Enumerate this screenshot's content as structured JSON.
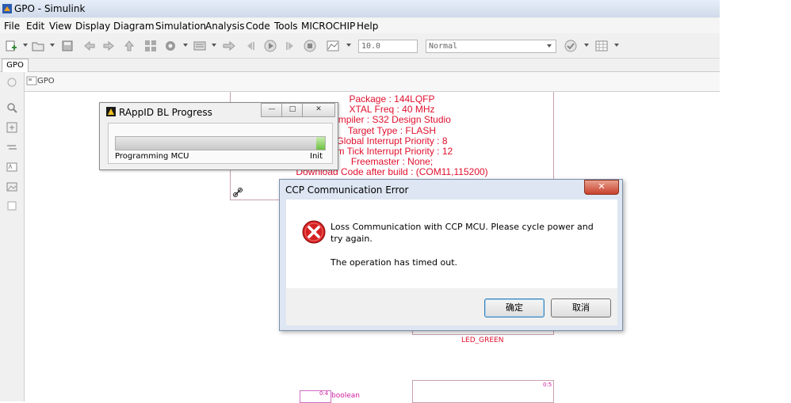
{
  "window": {
    "title": "GPO - Simulink"
  },
  "menu": [
    "File",
    "Edit",
    "View",
    "Display",
    "Diagram",
    "Simulation",
    "Analysis",
    "Code",
    "Tools",
    "MICROCHIP",
    "Help"
  ],
  "toolbar": {
    "stop_time": "10.0",
    "sim_mode": "Normal"
  },
  "tab": {
    "label": "GPO"
  },
  "breadcrumb": {
    "model": "GPO"
  },
  "config_block": {
    "lines": [
      "Package : 144LQFP",
      "XTAL Freq : 40 MHz",
      "ompiler : S32 Design Studio",
      "Target Type : FLASH",
      "Global Interrupt Priority : 8",
      "em Tick Interrupt Priority : 12",
      "Freemaster : None;",
      "Download Code after build : (COM11,115200)"
    ]
  },
  "blocks": {
    "led_label": "LED_GREEN",
    "bool_port": "0:4",
    "bool_label": "boolean",
    "bottom_port": "0:5"
  },
  "progress_window": {
    "title": "RAppID BL Progress",
    "status": "Programming MCU",
    "state": "Init",
    "progress": 0.04,
    "buttons": {
      "minimize": "—",
      "restore": "□",
      "close": "✕"
    }
  },
  "error_dialog": {
    "title": "CCP Communication Error",
    "message": "Loss Communication with CCP MCU. Please cycle power and try again.",
    "detail": "The operation has timed out.",
    "ok_label": "确定",
    "cancel_label": "取消",
    "close_glyph": "✕"
  },
  "colors": {
    "block_text": "#e0102e",
    "error_icon": "#d42020",
    "ok_border": "#3c7fb1"
  }
}
